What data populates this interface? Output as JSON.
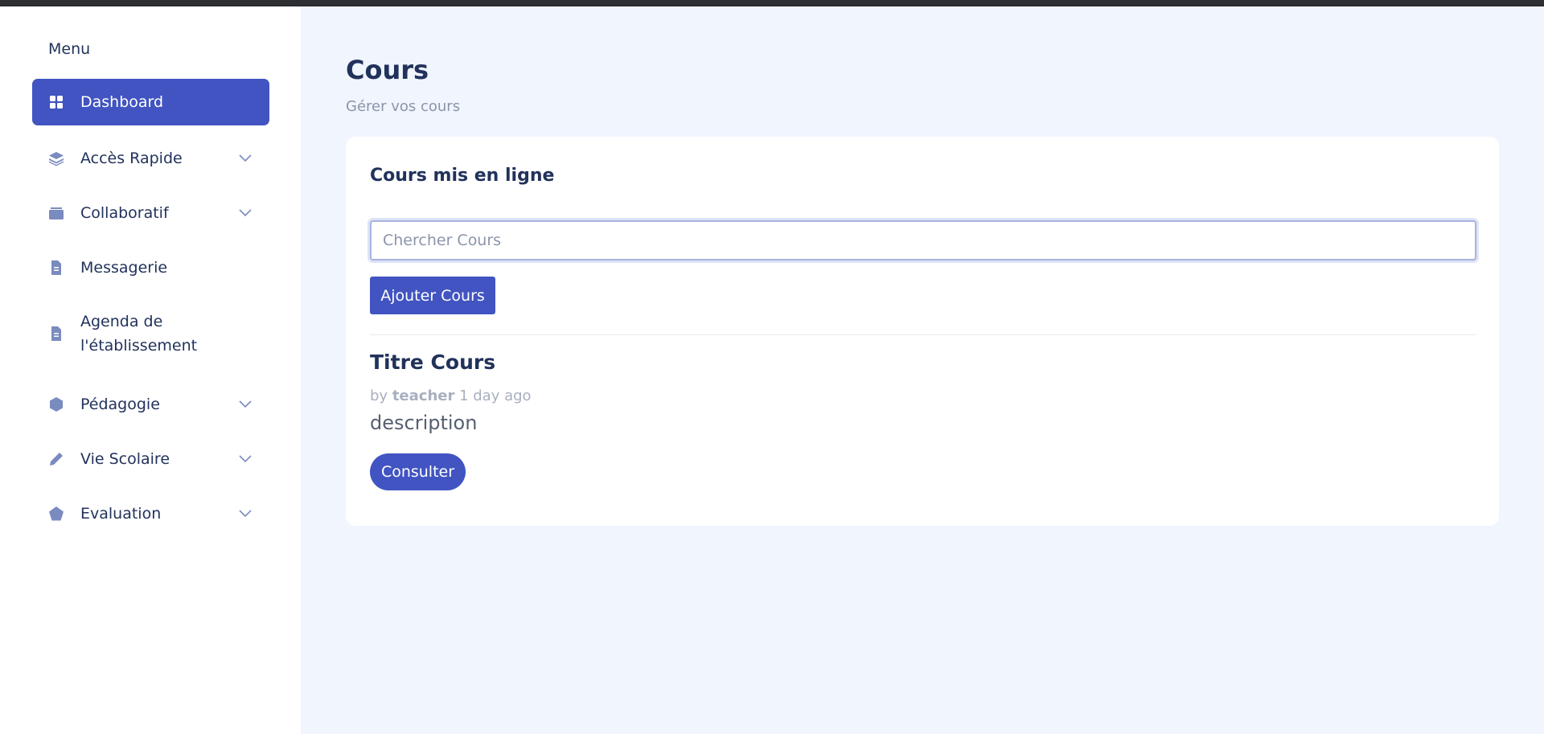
{
  "sidebar": {
    "menu_title": "Menu",
    "items": [
      {
        "label": "Dashboard",
        "icon": "grid-icon",
        "expandable": false,
        "active": true
      },
      {
        "label": "Accès Rapide",
        "icon": "layers-icon",
        "expandable": true
      },
      {
        "label": "Collaboratif",
        "icon": "briefcase-icon",
        "expandable": true
      },
      {
        "label": "Messagerie",
        "icon": "document-icon",
        "expandable": false
      },
      {
        "label": "Agenda de l'établissement",
        "icon": "document-icon",
        "expandable": false
      },
      {
        "label": "Pédagogie",
        "icon": "hexagon-icon",
        "expandable": true
      },
      {
        "label": "Vie Scolaire",
        "icon": "pen-icon",
        "expandable": true
      },
      {
        "label": "Evaluation",
        "icon": "pentagon-icon",
        "expandable": true
      }
    ]
  },
  "header": {
    "title": "Cours",
    "subtitle": "Gérer vos cours"
  },
  "card": {
    "title": "Cours mis en ligne",
    "search_placeholder": "Chercher Cours",
    "search_value": "",
    "add_button": "Ajouter Cours"
  },
  "course": {
    "title": "Titre Cours",
    "by": "by",
    "author": "teacher",
    "time": "1 day ago",
    "description": "description",
    "consult_button": "Consulter"
  },
  "colors": {
    "accent": "#4154c1",
    "text": "#21325b",
    "muted": "#8b95a9",
    "background": "#f0f5fe",
    "icon": "#7a8bbf"
  }
}
